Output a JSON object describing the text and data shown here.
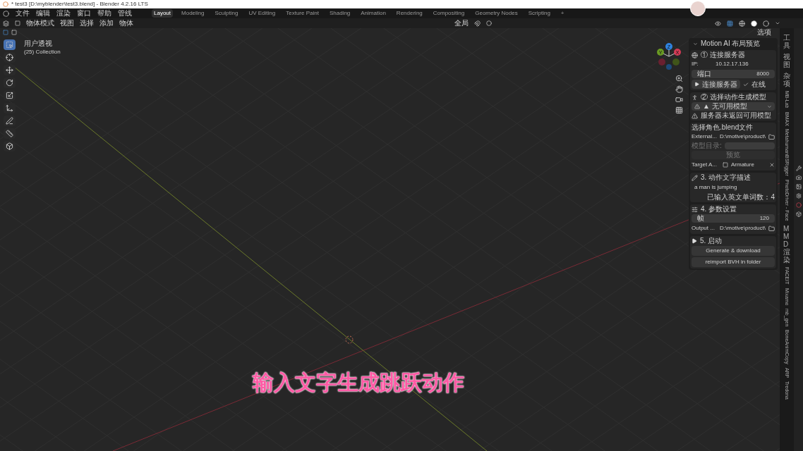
{
  "window": {
    "title": "* test3 [D:\\myblender\\test3.blend] - Blender 4.2.16 LTS"
  },
  "menu": [
    "文件",
    "编辑",
    "渲染",
    "窗口",
    "帮助",
    "管线"
  ],
  "workspaces": [
    {
      "label": "Layout",
      "selected": true
    },
    {
      "label": "Modeling",
      "selected": false
    },
    {
      "label": "Sculpting",
      "selected": false
    },
    {
      "label": "UV Editing",
      "selected": false
    },
    {
      "label": "Texture Paint",
      "selected": false
    },
    {
      "label": "Shading",
      "selected": false
    },
    {
      "label": "Animation",
      "selected": false
    },
    {
      "label": "Rendering",
      "selected": false
    },
    {
      "label": "Compositing",
      "selected": false
    },
    {
      "label": "Geometry Nodes",
      "selected": false
    },
    {
      "label": "Scripting",
      "selected": false
    },
    {
      "label": "+",
      "selected": false
    }
  ],
  "header": {
    "mode": "物体模式",
    "menus": [
      "视图",
      "选择",
      "添加",
      "物体"
    ],
    "orientation": "全局",
    "options": "选项"
  },
  "viewport": {
    "view_name": "用户透视",
    "collection": "(25) Collection"
  },
  "tools": [
    {
      "kind": "select",
      "selected": true
    },
    {
      "kind": "cursor",
      "selected": false
    },
    {
      "kind": "move",
      "selected": false
    },
    {
      "kind": "rotate",
      "selected": false
    },
    {
      "kind": "scale",
      "selected": false
    },
    {
      "kind": "transform",
      "selected": false
    },
    {
      "kind": "annotate",
      "selected": false
    },
    {
      "kind": "measure",
      "selected": false
    },
    {
      "kind": "add-cube",
      "selected": false
    }
  ],
  "gizmo": [
    {
      "label": "Z",
      "color": "#2f83e0"
    },
    {
      "label": "Y",
      "color": "#6a9a23"
    },
    {
      "label": "X",
      "color": "#d33a55"
    }
  ],
  "panel": {
    "title": "Motion AI 布局预览",
    "server": {
      "heading": "① 连接服务器",
      "ip_label": "IP:",
      "ip": "10.12.17.136",
      "port_label": "端口",
      "port": "8000",
      "connect": "连接服务器",
      "status": "在线",
      "online": true
    },
    "model": {
      "heading": "② 选择动作生成模型",
      "dropdown": "▲ 无可用模型",
      "warning": "服务器未返回可用模型"
    },
    "character": {
      "heading": "选择角色.blend文件",
      "external_label": "External...",
      "external_path": "D:\\motive\\product\\",
      "dir_label": "模型目录:",
      "preview": "预览",
      "target_label": "Target A...",
      "target": "Armature"
    },
    "text": {
      "heading": "3. 动作文字描述",
      "value": "a man is jumping",
      "count": "已输入英文单词数：4"
    },
    "params": {
      "heading": "4. 参数设置",
      "frames_label": "帧",
      "frames": "120",
      "output_label": "Output ...",
      "output_path": "D:\\motive\\product\\"
    },
    "launch": {
      "heading": "5. 启动",
      "buttons": [
        "Generate & download",
        "reimport BVH in folder"
      ]
    }
  },
  "side_tabs": [
    {
      "label": "工具",
      "kind": "cjk"
    },
    {
      "label": "视图",
      "kind": "cjk"
    },
    {
      "label": "杂项",
      "kind": "cjk"
    },
    {
      "label": "MB-Lab",
      "kind": "latin"
    },
    {
      "label": "BMAX",
      "kind": "latin"
    },
    {
      "label": "MetahumanBSRigger",
      "kind": "latin"
    },
    {
      "label": "PhotoDriver - Face",
      "kind": "latin"
    },
    {
      "label": "MMD渲染",
      "kind": "cjk"
    },
    {
      "label": "FACEIT",
      "kind": "latin"
    },
    {
      "label": "Mixamo",
      "kind": "latin"
    },
    {
      "label": "mb_gen",
      "kind": "latin"
    },
    {
      "label": "BoneAnimCopy",
      "kind": "latin"
    },
    {
      "label": "ARP",
      "kind": "latin"
    },
    {
      "label": "Tredona",
      "kind": "latin"
    }
  ],
  "caption": "输入文字生成跳跃动作"
}
